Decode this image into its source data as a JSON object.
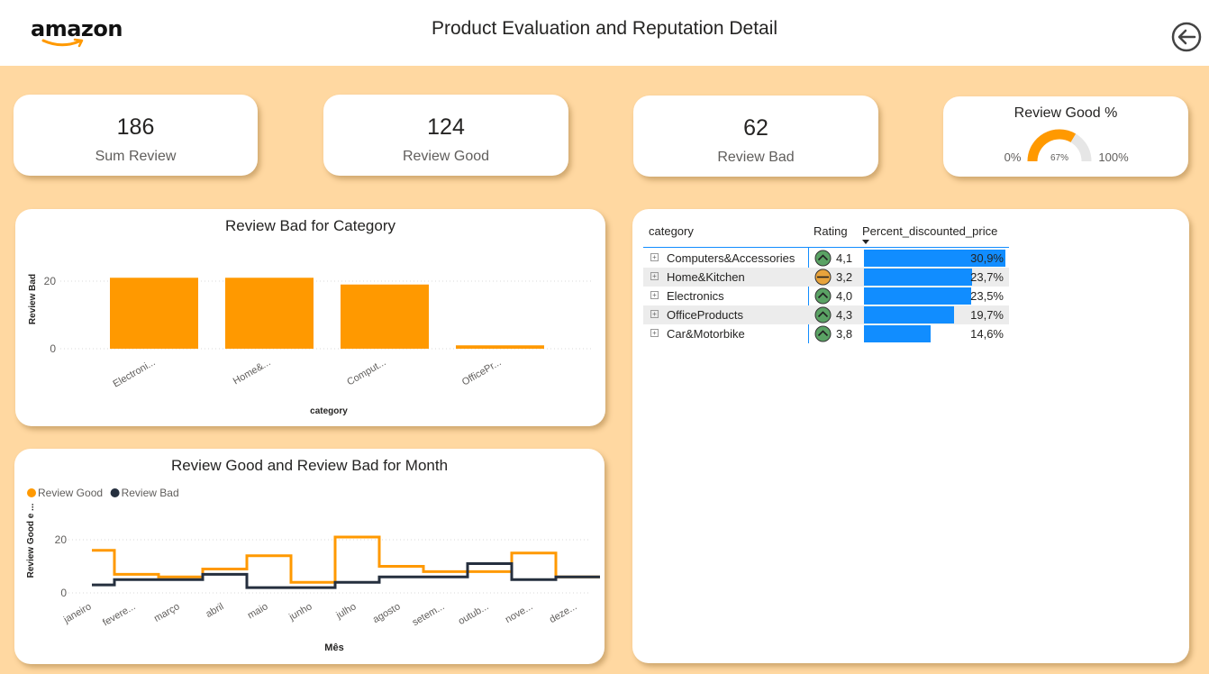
{
  "header": {
    "logo_text": "amazon",
    "title": "Product Evaluation and Reputation Detail",
    "back_icon": "back-arrow-icon"
  },
  "kpis": [
    {
      "value": "186",
      "label": "Sum Review"
    },
    {
      "value": "124",
      "label": "Review Good"
    },
    {
      "value": "62",
      "label": "Review Bad"
    }
  ],
  "gauge": {
    "title": "Review Good %",
    "min_label": "0%",
    "max_label": "100%",
    "value_label": "67%",
    "value": 0.67,
    "fill_color": "#ff9900",
    "track_color": "#e6e6e6"
  },
  "bar_chart": {
    "title": "Review Bad for Category",
    "chart_data": {
      "type": "bar",
      "categories": [
        "Electroni...",
        "Home&...",
        "Comput...",
        "OfficePr..."
      ],
      "values": [
        21,
        21,
        19,
        1
      ],
      "xlabel": "category",
      "ylabel": "Review Bad",
      "yticks": [
        0,
        20
      ],
      "ylim": [
        0,
        25
      ],
      "color": "#ff9900",
      "grid": true
    }
  },
  "line_chart": {
    "title": "Review Good and Review Bad for Month",
    "chart_data": {
      "type": "line",
      "step": true,
      "categories": [
        "janeiro",
        "fevere...",
        "março",
        "abril",
        "maio",
        "junho",
        "julho",
        "agosto",
        "setem...",
        "outub...",
        "nove...",
        "deze..."
      ],
      "series": [
        {
          "name": "Review Good",
          "color": "#ff9900",
          "values": [
            16,
            7,
            6,
            9,
            14,
            4,
            21,
            10,
            8,
            8,
            15,
            6
          ]
        },
        {
          "name": "Review Bad",
          "color": "#252f3e",
          "values": [
            3,
            5,
            5,
            7,
            2,
            2,
            4,
            6,
            6,
            11,
            5,
            6
          ]
        }
      ],
      "xlabel": "Mês",
      "ylabel": "Review Good e ...",
      "yticks": [
        0,
        20
      ],
      "ylim": [
        0,
        25
      ],
      "legend": "top-left",
      "grid": true
    }
  },
  "table": {
    "headers": {
      "category": "category",
      "rating": "Rating",
      "pct": "Percent_discounted_price"
    },
    "sort_icon": "sort-descending-icon",
    "rows": [
      {
        "category": "Computers&Accessories",
        "rating": "4,1",
        "rating_icon": "up-arrow-circle-icon",
        "icon_color": "#5aa264",
        "pct_label": "30,9%",
        "pct_value": 30.9
      },
      {
        "category": "Home&Kitchen",
        "rating": "3,2",
        "rating_icon": "neutral-circle-icon",
        "icon_color": "#e8a33c",
        "pct_label": "23,7%",
        "pct_value": 23.7
      },
      {
        "category": "Electronics",
        "rating": "4,0",
        "rating_icon": "up-arrow-circle-icon",
        "icon_color": "#5aa264",
        "pct_label": "23,5%",
        "pct_value": 23.5
      },
      {
        "category": "OfficeProducts",
        "rating": "4,3",
        "rating_icon": "up-arrow-circle-icon",
        "icon_color": "#5aa264",
        "pct_label": "19,7%",
        "pct_value": 19.7
      },
      {
        "category": "Car&Motorbike",
        "rating": "3,8",
        "rating_icon": "up-arrow-circle-icon",
        "icon_color": "#5aa264",
        "pct_label": "14,6%",
        "pct_value": 14.6
      }
    ],
    "bar_color": "#118dff"
  }
}
